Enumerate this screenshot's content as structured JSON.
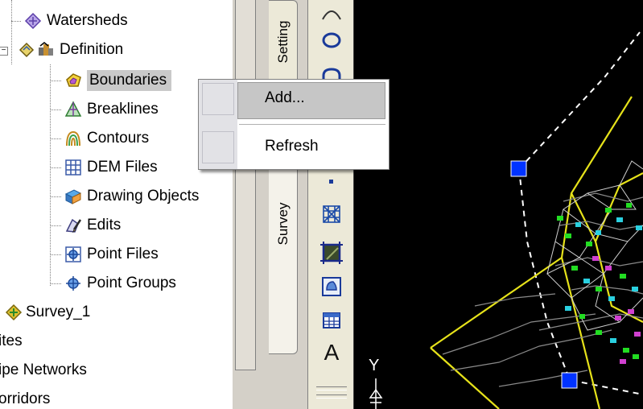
{
  "tree": {
    "items": [
      {
        "label": "Watersheds",
        "icon": "watersheds-icon"
      },
      {
        "label": "Definition",
        "icon": "definition-icon"
      },
      {
        "label": "Boundaries",
        "icon": "boundaries-icon"
      },
      {
        "label": "Breaklines",
        "icon": "breaklines-icon"
      },
      {
        "label": "Contours",
        "icon": "contours-icon"
      },
      {
        "label": "DEM Files",
        "icon": "dem-files-icon"
      },
      {
        "label": "Drawing Objects",
        "icon": "drawing-objects-icon"
      },
      {
        "label": "Edits",
        "icon": "edits-icon"
      },
      {
        "label": "Point Files",
        "icon": "point-files-icon"
      },
      {
        "label": "Point Groups",
        "icon": "point-groups-icon"
      },
      {
        "label": "Survey_1",
        "icon": "survey-icon"
      },
      {
        "label": "ites"
      },
      {
        "label": "ipe Networks"
      },
      {
        "label": "orridors"
      }
    ],
    "selected": "Boundaries",
    "expander_minus": "−"
  },
  "tabs": {
    "settings": "Setting",
    "survey": "Survey"
  },
  "palette": {
    "tools": [
      "ellipse-tool-icon",
      "circle-tool-icon",
      "dot-tool-icon",
      "grid-crosshatch-icon",
      "hatch-square-icon",
      "drop-shape-icon",
      "table-icon",
      "text-tool-icon"
    ],
    "text_tool": "A"
  },
  "context_menu": {
    "items": [
      {
        "label": "Add...",
        "state": "hover"
      },
      {
        "label": "Refresh"
      }
    ]
  },
  "canvas": {
    "background": "#000000",
    "boundary_color": "#ffff00",
    "grip_color": "#0033ff",
    "ucs_label": "Y"
  }
}
